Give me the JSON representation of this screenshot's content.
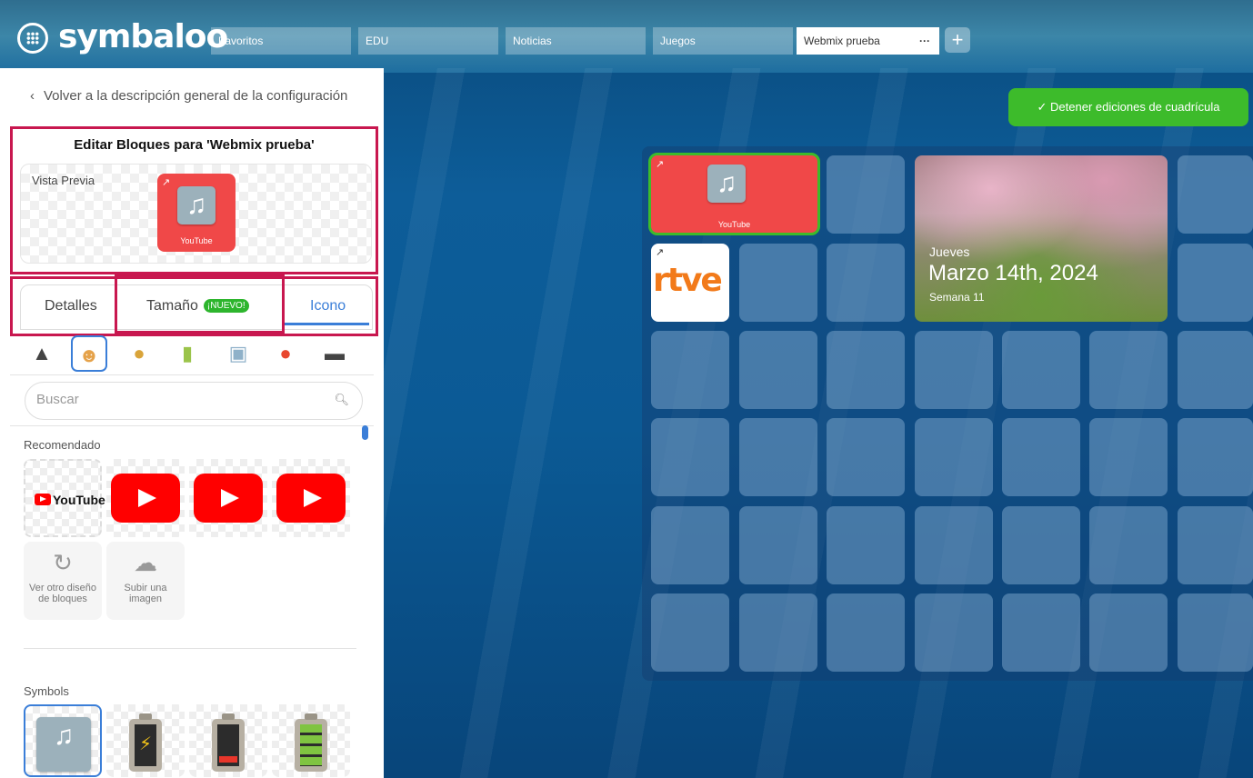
{
  "app": {
    "logo_text": "symbaloo"
  },
  "tabs": [
    {
      "label": "Favoritos"
    },
    {
      "label": "EDU"
    },
    {
      "label": "Noticias"
    },
    {
      "label": "Juegos"
    },
    {
      "label": "Webmix prueba",
      "more": "···"
    }
  ],
  "add_tab_label": "+",
  "panel": {
    "back_label": "Volver a la descripción general de la configuración",
    "edit_title": "Editar Bloques para 'Webmix prueba'",
    "preview_label": "Vista Previa",
    "preview_tile_caption": "YouTube",
    "tabs": {
      "details": "Detalles",
      "size": "Tamaño",
      "new_badge": "¡NUEVO!",
      "icon": "Icono"
    },
    "icon_categories": [
      "image-icon",
      "person-icon",
      "paw-icon",
      "pencil-icon",
      "washer-icon",
      "apple-icon",
      "hat-icon"
    ],
    "search_placeholder": "Buscar",
    "recommended_heading": "Recomendado",
    "youtube_logo_text": "YouTube",
    "other_design_label": "Ver otro diseño de bloques",
    "upload_label": "Subir una imagen",
    "symbols_heading": "Symbols"
  },
  "grid": {
    "stop_button_label": "Detener ediciones de cuadrícula",
    "youtube_tile_caption": "YouTube",
    "rtve_text": "rtve",
    "date_widget": {
      "day": "Jueves",
      "date": "Marzo 14th, 2024",
      "week": "Semana 11"
    }
  },
  "colors": {
    "accent": "#3a7ed8",
    "highlight_border": "#c8174f",
    "green": "#3dbb2b",
    "tile_red": "#f04848"
  }
}
